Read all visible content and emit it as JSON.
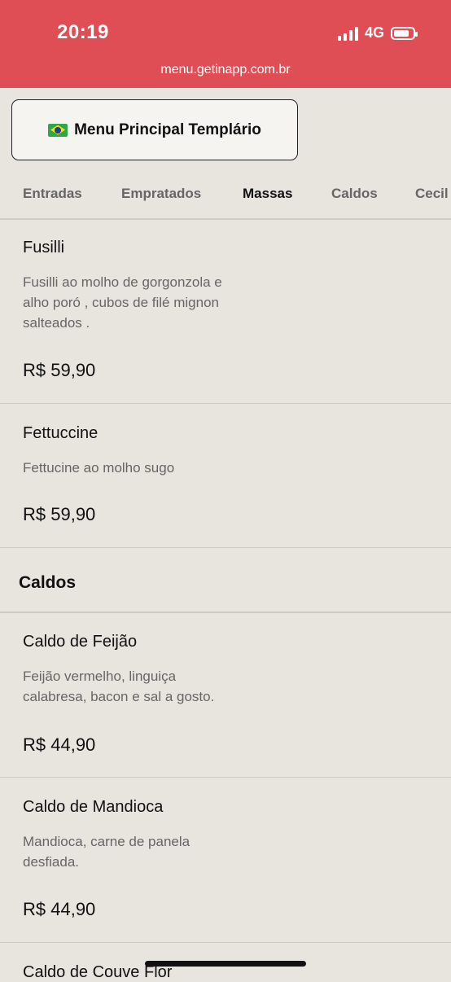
{
  "status_bar": {
    "time": "20:19",
    "network": "4G",
    "url": "menu.getinapp.com.br"
  },
  "menu_button": {
    "label": "Menu Principal Templário"
  },
  "tabs": [
    {
      "label": "Entradas",
      "active": false
    },
    {
      "label": "Empratados",
      "active": false
    },
    {
      "label": "Massas",
      "active": true
    },
    {
      "label": "Caldos",
      "active": false
    },
    {
      "label": "Cecil",
      "active": false
    }
  ],
  "items": [
    {
      "name": "Fusilli",
      "desc_lines": [
        "Fusilli ao molho de gorgonzola e",
        "alho poró , cubos de filé mignon",
        "salteados ."
      ],
      "price": "R$ 59,90"
    },
    {
      "name": "Fettuccine",
      "desc_lines": [
        "Fettucine ao molho sugo"
      ],
      "price": "R$ 59,90"
    }
  ],
  "section_caldos": {
    "title": "Caldos"
  },
  "caldos_items": [
    {
      "name": "Caldo de Feijão",
      "desc_lines": [
        "Feijão vermelho, linguiça",
        "calabresa, bacon e sal a gosto."
      ],
      "price": "R$ 44,90"
    },
    {
      "name": "Caldo de Mandioca",
      "desc_lines": [
        "Mandioca, carne de panela",
        "desfiada."
      ],
      "price": "R$ 44,90"
    },
    {
      "name": "Caldo de Couve Flor"
    }
  ],
  "colors": {
    "header": "#e04e55",
    "background": "#e8e4de",
    "active_tab": "#111111",
    "inactive_tab": "#666666"
  }
}
